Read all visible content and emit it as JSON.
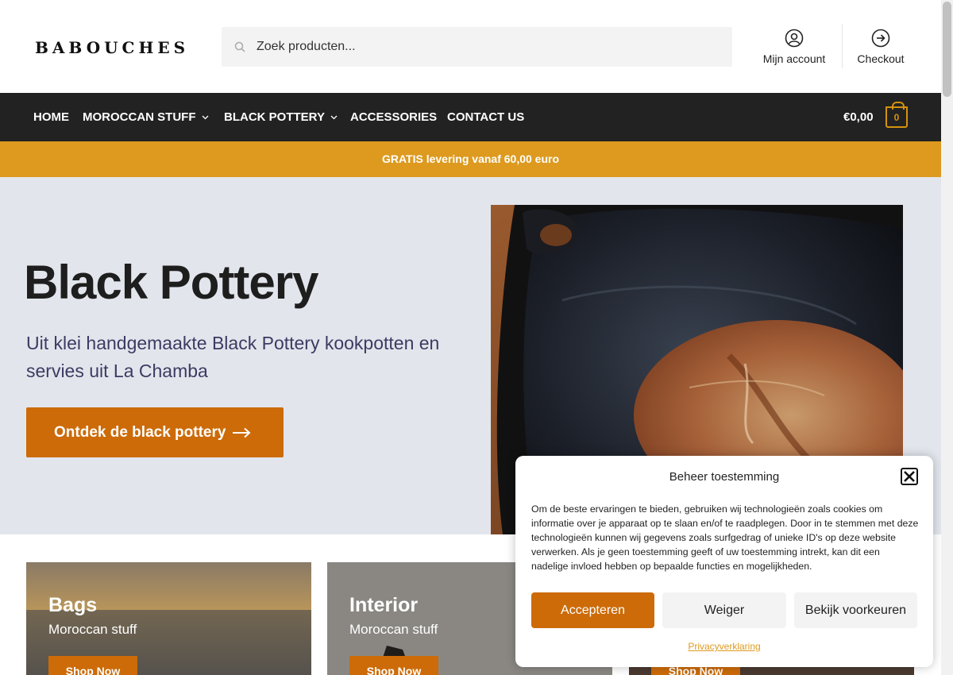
{
  "header": {
    "logo": "BABOUCHES",
    "search_placeholder": "Zoek producten...",
    "account_label": "Mijn account",
    "checkout_label": "Checkout"
  },
  "nav": {
    "items": [
      {
        "label": "HOME"
      },
      {
        "label": "MOROCCAN STUFF"
      },
      {
        "label": "BLACK POTTERY"
      },
      {
        "label": "ACCESSORIES"
      },
      {
        "label": "CONTACT US"
      }
    ],
    "cart_total": "€0,00",
    "cart_count": "0"
  },
  "promo": {
    "text": "GRATIS levering vanaf 60,00 euro"
  },
  "hero": {
    "title": "Black Pottery",
    "subtitle": "Uit klei handgemaakte Black Pottery kookpotten en servies uit La Chamba",
    "button_label": "Ontdek de black pottery"
  },
  "cards": [
    {
      "title": "Bags",
      "subtitle": "Moroccan stuff",
      "button": "Shop Now"
    },
    {
      "title": "Interior",
      "subtitle": "Moroccan stuff",
      "button": "Shop Now"
    },
    {
      "title": "",
      "subtitle": "",
      "button": "Shop Now"
    }
  ],
  "consent": {
    "title": "Beheer toestemming",
    "body": "Om de beste ervaringen te bieden, gebruiken wij technologieën zoals cookies om informatie over je apparaat op te slaan en/of te raadplegen. Door in te stemmen met deze technologieën kunnen wij gegevens zoals surfgedrag of unieke ID's op deze website verwerken. Als je geen toestemming geeft of uw toestemming intrekt, kan dit een nadelige invloed hebben op bepaalde functies en mogelijkheden.",
    "accept": "Accepteren",
    "deny": "Weiger",
    "preferences": "Bekijk voorkeuren",
    "privacy": "Privacyverklaring"
  },
  "colors": {
    "accent": "#cc6b08",
    "promo": "#dd9a1f",
    "nav_bg": "#222222",
    "hero_bg": "#e2e6ec"
  }
}
